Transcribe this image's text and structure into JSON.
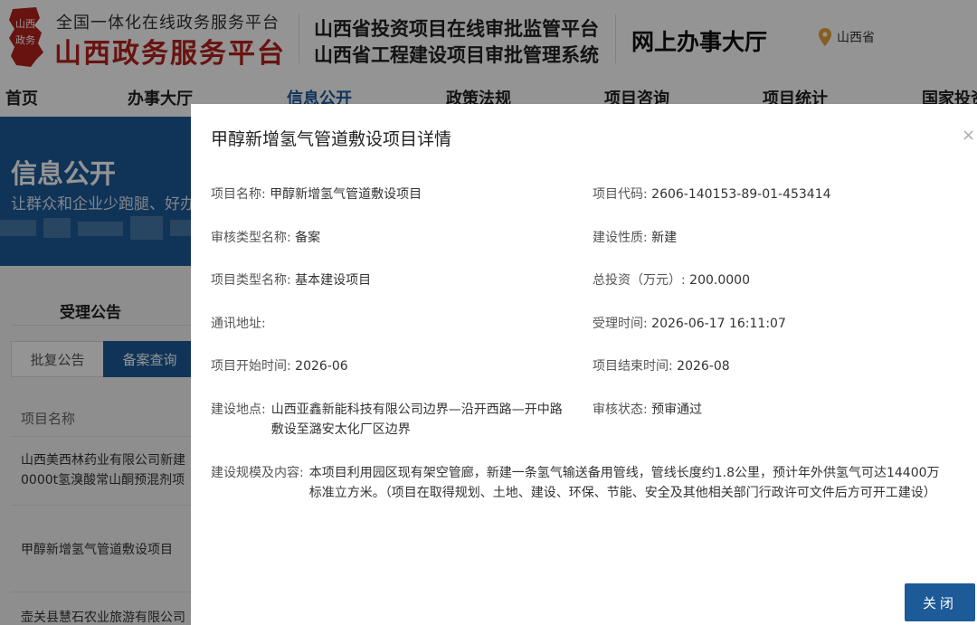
{
  "header": {
    "brand_small": "全国一体化在线政务服务平台",
    "brand_big": "山西政务服务平台",
    "seal_text": "山西政务",
    "system_line1": "山西省投资项目在线审批监管平台",
    "system_line2": "山西省工程建设项目审批管理系统",
    "hall": "网上办事大厅",
    "location": "山西省"
  },
  "nav": {
    "items": [
      {
        "label": "首页"
      },
      {
        "label": "办事大厅"
      },
      {
        "label": "信息公开"
      },
      {
        "label": "政策法规"
      },
      {
        "label": "项目咨询"
      },
      {
        "label": "项目统计"
      },
      {
        "label": "国家投资"
      }
    ],
    "active": "信息公开"
  },
  "banner": {
    "title": "信息公开",
    "subtitle": "让群众和企业少跑腿、好办事"
  },
  "sidebar": {
    "section_title": "受理公告",
    "tabs": [
      {
        "label": "批复公告"
      },
      {
        "label": "备案查询"
      }
    ],
    "column_header": "项目名称",
    "rows": [
      {
        "line1": "山西美西林药业有限公司新建",
        "line2": "0000t氢溴酸常山酮预混剂项"
      },
      {
        "line1": "甲醇新增氢气管道敷设项目",
        "line2": ""
      },
      {
        "line1": "壶关县慧石农业旅游有限公司",
        "line2": ""
      }
    ]
  },
  "modal": {
    "title": "甲醇新增氢气管道敷设项目详情",
    "close_icon": "×",
    "close_button": "关闭",
    "fields": {
      "project_name": {
        "label": "项目名称:",
        "value": "甲醇新增氢气管道敷设项目"
      },
      "project_code": {
        "label": "项目代码:",
        "value": "2606-140153-89-01-453414"
      },
      "review_type": {
        "label": "审核类型名称:",
        "value": "备案"
      },
      "nature": {
        "label": "建设性质:",
        "value": "新建"
      },
      "project_type": {
        "label": "项目类型名称:",
        "value": "基本建设项目"
      },
      "investment": {
        "label": "总投资（万元）:",
        "value": "200.0000"
      },
      "address": {
        "label": "通讯地址:",
        "value": ""
      },
      "accept_time": {
        "label": "受理时间:",
        "value": "2026-06-17 16:11:07"
      },
      "start_time": {
        "label": "项目开始时间:",
        "value": "2026-06"
      },
      "end_time": {
        "label": "项目结束时间:",
        "value": "2026-08"
      },
      "location": {
        "label": "建设地点:",
        "value": "山西亚鑫新能科技有限公司边界—沿开西路—开中路敷设至潞安太化厂区边界"
      },
      "status": {
        "label": "审核状态:",
        "value": "预审通过"
      },
      "scale": {
        "label": "建设规模及内容:",
        "value": "本项目利用园区现有架空管廊，新建一条氢气输送备用管线，管线长度约1.8公里，预计年外供氢气可达14400万标准立方米。（项目在取得规划、土地、建设、环保、节能、安全及其他相关部门行政许可文件后方可开工建设）"
      }
    }
  },
  "colors": {
    "primary": "#1c5a98",
    "brand_red": "#b3221c",
    "location_pin": "#e8a23a"
  }
}
